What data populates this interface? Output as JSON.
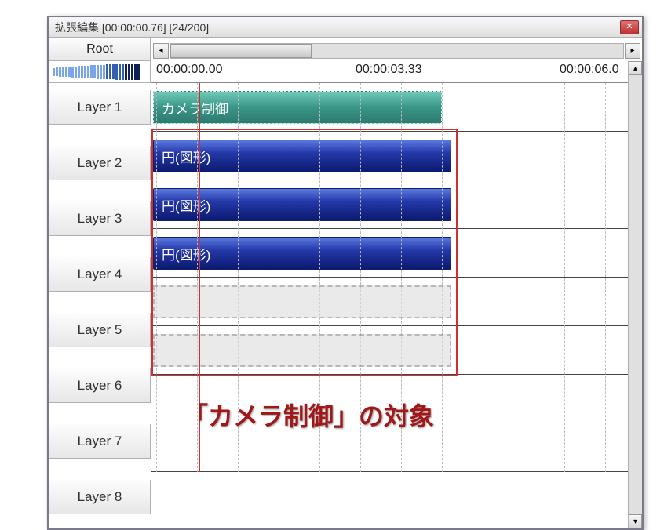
{
  "window": {
    "title": "拡張編集 [00:00:00.76] [24/200]"
  },
  "root_button": "Root",
  "timestamps": [
    "00:00:00.00",
    "00:00:03.33",
    "00:00:06.0"
  ],
  "layers": [
    {
      "label": "Layer 1"
    },
    {
      "label": "Layer 2"
    },
    {
      "label": "Layer 3"
    },
    {
      "label": "Layer 4"
    },
    {
      "label": "Layer 5"
    },
    {
      "label": "Layer 6"
    },
    {
      "label": "Layer 7"
    },
    {
      "label": "Layer 8"
    }
  ],
  "clips": {
    "camera_control": "カメラ制御",
    "circle_shape": "円(図形)"
  },
  "annotation": "「カメラ制御」の対象",
  "icons": {
    "close": "✕",
    "left": "◂",
    "right": "▸",
    "up": "▴",
    "down": "▾"
  },
  "colors": {
    "playhead": "#d03030",
    "selection": "#d03030",
    "camera_clip": "#3a9688",
    "shape_clip": "#2538a8"
  }
}
